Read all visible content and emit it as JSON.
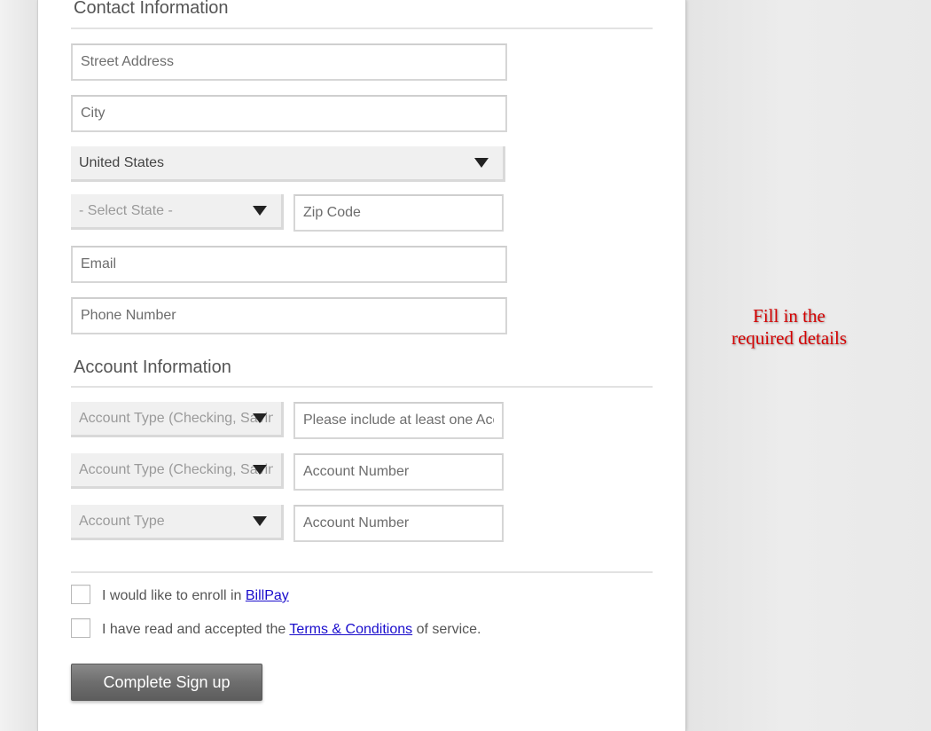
{
  "contact": {
    "title": "Contact Information",
    "street_placeholder": "Street Address",
    "city_placeholder": "City",
    "country_value": "United States",
    "state_value": "- Select State -",
    "zip_placeholder": "Zip Code",
    "email_placeholder": "Email",
    "phone_placeholder": "Phone Number"
  },
  "account": {
    "title": "Account Information",
    "rows": [
      {
        "type_value": "Account Type (Checking, Savings)",
        "number_placeholder": "Please include at least one Account"
      },
      {
        "type_value": "Account Type (Checking, Savings)",
        "number_placeholder": "Account Number"
      },
      {
        "type_value": "Account Type",
        "number_placeholder": "Account Number"
      }
    ]
  },
  "agreements": {
    "billpay_prefix": "I would like to enroll in ",
    "billpay_link": "BillPay",
    "terms_prefix": "I have read and accepted the ",
    "terms_link": "Terms & Conditions",
    "terms_suffix": " of service."
  },
  "submit_label": "Complete Sign up",
  "hint": {
    "line1": "Fill in the",
    "line2": "required details"
  },
  "colors": {
    "link": "#1a0dcc",
    "hint": "#d40000",
    "button": "#6e6e6e"
  }
}
